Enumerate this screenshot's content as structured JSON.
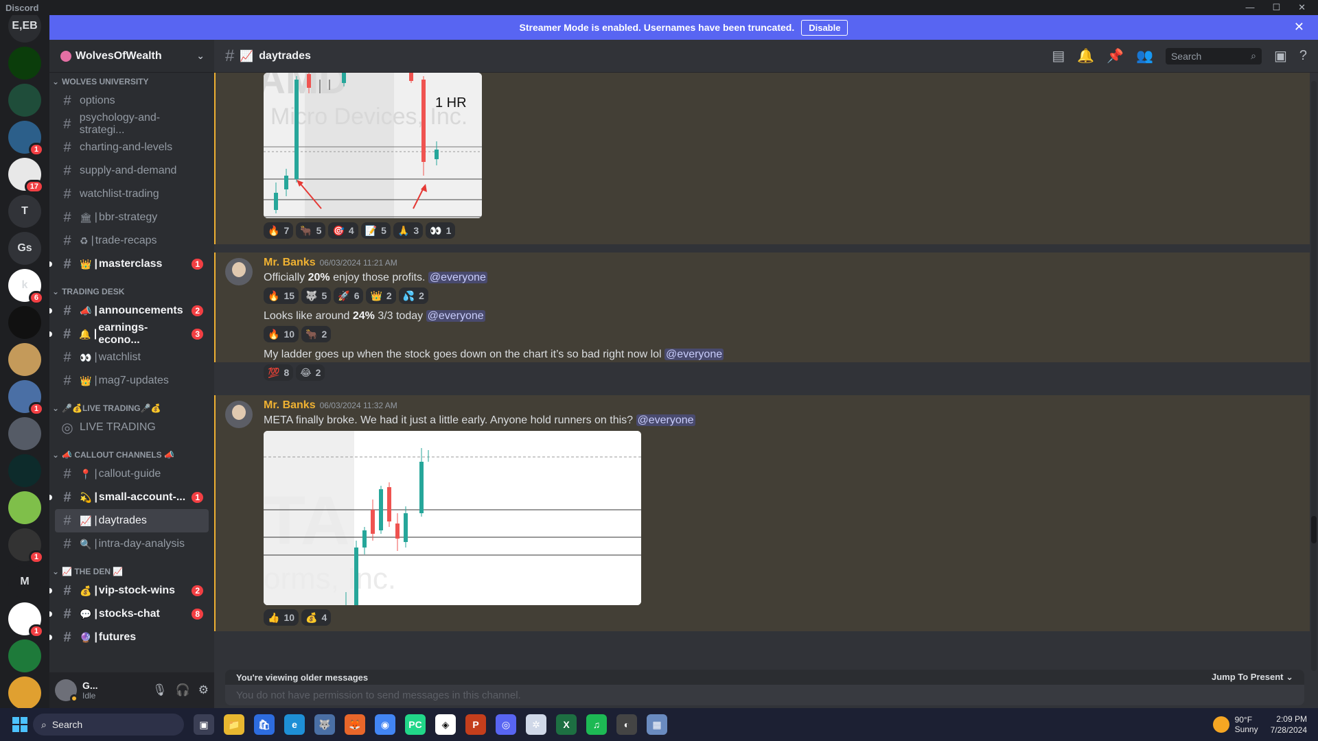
{
  "window": {
    "app_title": "Discord",
    "minimize": "—",
    "maximize": "☐",
    "close": "✕"
  },
  "streamer_bar": {
    "text": "Streamer Mode is enabled. Usernames have been truncated.",
    "button": "Disable",
    "close": "✕"
  },
  "guilds": [
    {
      "label": "E,EB",
      "color": "#2b2d31",
      "badge": ""
    },
    {
      "label": "",
      "color": "#0b3d0b",
      "badge": ""
    },
    {
      "label": "",
      "color": "#1f4d3a",
      "badge": ""
    },
    {
      "label": "",
      "color": "#2c5f8a",
      "badge": "1"
    },
    {
      "label": "",
      "color": "#e8e8e8",
      "badge": "17"
    },
    {
      "label": "T",
      "color": "#313338",
      "badge": ""
    },
    {
      "label": "Gs",
      "color": "#313338",
      "badge": ""
    },
    {
      "label": "k",
      "color": "#ffffff",
      "badge": "6"
    },
    {
      "label": "",
      "color": "#111111",
      "badge": ""
    },
    {
      "label": "",
      "color": "#c49a5a",
      "badge": ""
    },
    {
      "label": "",
      "color": "#4a6fa5",
      "badge": "1"
    },
    {
      "label": "",
      "color": "#555b66",
      "badge": ""
    },
    {
      "label": "",
      "color": "#0d2b2b",
      "badge": ""
    },
    {
      "label": "",
      "color": "#7fbf4a",
      "badge": ""
    },
    {
      "label": "",
      "color": "#333333",
      "badge": "1"
    },
    {
      "label": "M",
      "color": "#1e1f22",
      "badge": ""
    },
    {
      "label": "",
      "color": "#ffffff",
      "badge": "1"
    },
    {
      "label": "",
      "color": "#1e7a3a",
      "badge": ""
    },
    {
      "label": "",
      "color": "#e0a030",
      "badge": ""
    }
  ],
  "server": {
    "name": "WolvesOfWealth",
    "chevron": "⌄"
  },
  "categories": [
    {
      "name": "WOLVES UNIVERSITY",
      "channels": [
        {
          "name": "options",
          "emoji": "",
          "unread": false,
          "badge": ""
        },
        {
          "name": "psychology-and-strategi...",
          "emoji": "",
          "unread": false,
          "badge": ""
        },
        {
          "name": "charting-and-levels",
          "emoji": "",
          "unread": false,
          "badge": ""
        },
        {
          "name": "supply-and-demand",
          "emoji": "",
          "unread": false,
          "badge": ""
        },
        {
          "name": "watchlist-trading",
          "emoji": "",
          "unread": false,
          "badge": ""
        },
        {
          "name": "bbr-strategy",
          "emoji": "🏛",
          "unread": false,
          "badge": ""
        },
        {
          "name": "trade-recaps",
          "emoji": "♻",
          "unread": false,
          "badge": ""
        },
        {
          "name": "masterclass",
          "emoji": "👑",
          "unread": true,
          "badge": "1"
        }
      ]
    },
    {
      "name": "TRADING DESK",
      "channels": [
        {
          "name": "announcements",
          "emoji": "📣",
          "unread": true,
          "badge": "2"
        },
        {
          "name": "earnings-econo...",
          "emoji": "🔔",
          "unread": true,
          "badge": "3"
        },
        {
          "name": "watchlist",
          "emoji": "👀",
          "unread": false,
          "badge": ""
        },
        {
          "name": "mag7-updates",
          "emoji": "👑",
          "unread": false,
          "badge": ""
        }
      ]
    },
    {
      "name": "🎤💰LIVE TRADING🎤💰",
      "channels": [
        {
          "name": "LIVE TRADING",
          "emoji": "",
          "unread": false,
          "badge": "",
          "voice": true
        }
      ]
    },
    {
      "name": "📣 CALLOUT CHANNELS 📣",
      "channels": [
        {
          "name": "callout-guide",
          "emoji": "📍",
          "unread": false,
          "badge": ""
        },
        {
          "name": "small-account-...",
          "emoji": "💫",
          "unread": true,
          "badge": "1"
        },
        {
          "name": "daytrades",
          "emoji": "📈",
          "unread": false,
          "badge": "",
          "active": true
        },
        {
          "name": "intra-day-analysis",
          "emoji": "🔍",
          "unread": false,
          "badge": ""
        }
      ]
    },
    {
      "name": "📈 THE DEN 📈",
      "channels": [
        {
          "name": "vip-stock-wins",
          "emoji": "💰",
          "unread": true,
          "badge": "2"
        },
        {
          "name": "stocks-chat",
          "emoji": "💬",
          "unread": true,
          "badge": "8"
        },
        {
          "name": "futures",
          "emoji": "🔮",
          "unread": true,
          "badge": ""
        }
      ]
    }
  ],
  "user": {
    "name": "G...",
    "status": "Idle"
  },
  "channel_header": {
    "hash": "#",
    "emoji": "📈",
    "title": "daytrades",
    "search_placeholder": "Search"
  },
  "msg1": {
    "chart_label": "1 HR",
    "watermark": "Micro Devices, Inc.",
    "reactions": [
      {
        "e": "🔥",
        "n": "7"
      },
      {
        "e": "🐂",
        "n": "5"
      },
      {
        "e": "🎯",
        "n": "4"
      },
      {
        "e": "📝",
        "n": "5"
      },
      {
        "e": "🙏",
        "n": "3"
      },
      {
        "e": "👀",
        "n": "1"
      }
    ]
  },
  "msg2": {
    "author": "Mr. Banks",
    "timestamp": "06/03/2024 11:21 AM",
    "line1_pre": "Officially ",
    "line1_bold": "20%",
    "line1_post": " enjoy those profits. ",
    "line1_mention": "@everyone",
    "reactions1": [
      {
        "e": "🔥",
        "n": "15"
      },
      {
        "e": "🐺",
        "n": "5"
      },
      {
        "e": "🚀",
        "n": "6"
      },
      {
        "e": "👑",
        "n": "2"
      },
      {
        "e": "💦",
        "n": "2"
      }
    ],
    "line2_pre": "Looks like around ",
    "line2_bold": "24%",
    "line2_post": " 3/3 today ",
    "line2_mention": "@everyone",
    "reactions2": [
      {
        "e": "🔥",
        "n": "10"
      },
      {
        "e": "🐂",
        "n": "2"
      }
    ],
    "line3": "My ladder goes up when the stock goes down on the chart it’s so bad right now lol ",
    "line3_mention": "@everyone",
    "reactions3": [
      {
        "e": "💯",
        "n": "8"
      },
      {
        "e": "😂",
        "n": "2"
      }
    ]
  },
  "msg3": {
    "author": "Mr. Banks",
    "timestamp": "06/03/2024 11:32 AM",
    "text": "META finally broke. We had it just a little early. Anyone hold runners on this? ",
    "mention": "@everyone",
    "watermark_big": "TA",
    "watermark_small": "orms, Inc.",
    "reactions": [
      {
        "e": "👍",
        "n": "10"
      },
      {
        "e": "💰",
        "n": "4"
      }
    ]
  },
  "composer": {
    "older": "You're viewing older messages",
    "jump": "Jump To Present",
    "noperm": "You do not have permission to send messages in this channel."
  },
  "taskbar": {
    "search": "Search",
    "apps": [
      "▣",
      "📁",
      "🛍",
      "e",
      "🐺",
      "🦊",
      "◉",
      "PC",
      "◈",
      "P",
      "◎",
      "✲",
      "X",
      "♫",
      "◐",
      "▦"
    ],
    "weather_temp": "90°F",
    "weather_desc": "Sunny",
    "time": "2:09 PM",
    "date": "7/28/2024"
  }
}
